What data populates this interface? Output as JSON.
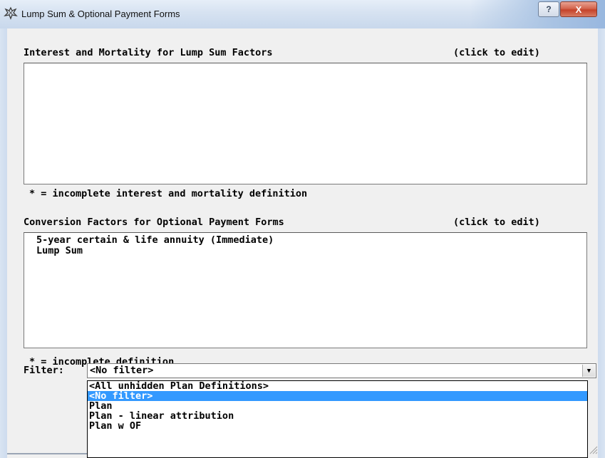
{
  "window": {
    "title": "Lump Sum & Optional Payment Forms",
    "help_label": "?",
    "close_label": "X"
  },
  "interest_section": {
    "heading": "Interest and Mortality for Lump Sum Factors",
    "edit_hint": "(click to edit)",
    "items": [],
    "footnote": "* = incomplete interest and mortality definition"
  },
  "conversion_section": {
    "heading": "Conversion Factors for Optional Payment Forms",
    "edit_hint": "(click to edit)",
    "items": [
      "5-year certain & life annuity (Immediate)",
      "Lump Sum"
    ],
    "footnote": "* = incomplete definition"
  },
  "filter": {
    "label": "Filter:",
    "selected": "<No filter>",
    "options": [
      "<All unhidden Plan Definitions>",
      "<No filter>",
      "Plan",
      "Plan - linear attribution",
      "Plan w OF"
    ],
    "highlighted_index": 1
  },
  "colors": {
    "selection": "#3399ff",
    "window_bg": "#f0f0f0"
  }
}
